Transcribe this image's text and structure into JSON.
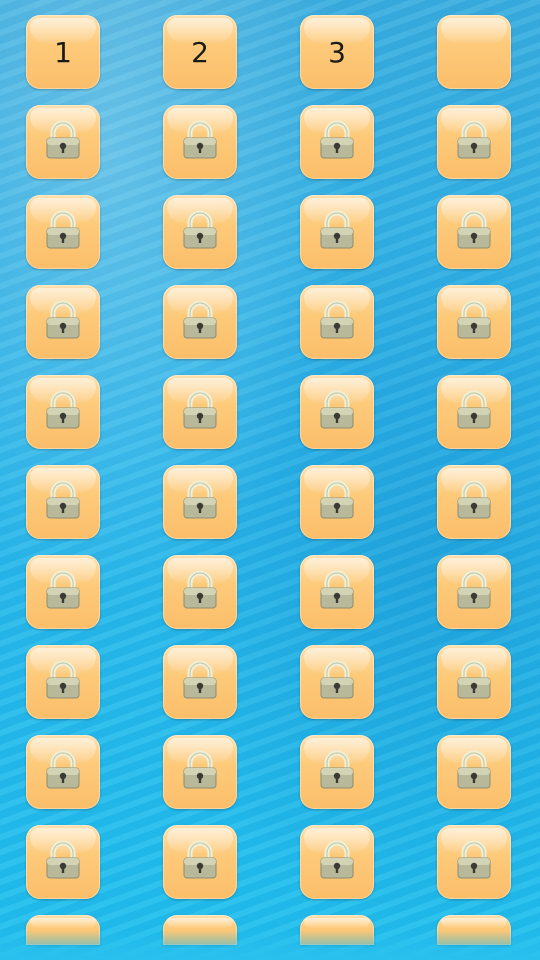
{
  "levels": {
    "unlocked": [
      "1",
      "2",
      "3",
      ""
    ],
    "columns": 4,
    "locked_rows": 9,
    "locked_icon": "padlock-icon",
    "partial_row_visible": true
  },
  "colors": {
    "tile": "#fbc876",
    "background": "#2bb6ea",
    "text": "#1a1a1a"
  }
}
